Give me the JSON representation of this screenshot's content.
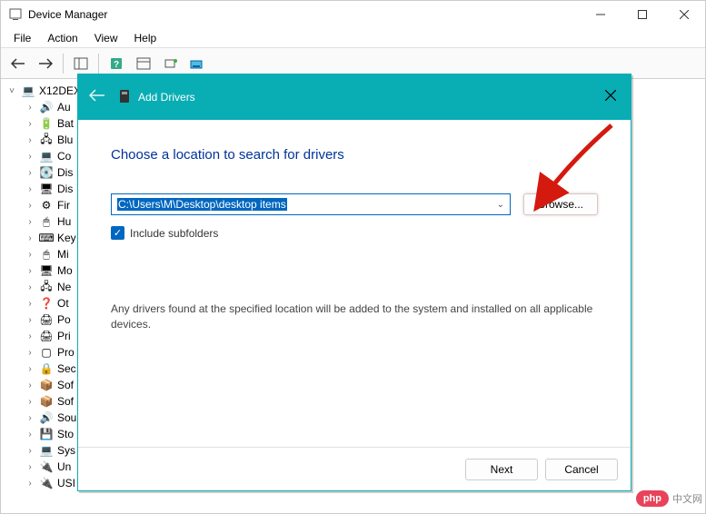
{
  "window": {
    "title": "Device Manager"
  },
  "menubar": {
    "items": [
      "File",
      "Action",
      "View",
      "Help"
    ]
  },
  "tree": {
    "root": "X12DEX",
    "items": [
      {
        "label": "Au",
        "icon": "🔊"
      },
      {
        "label": "Bat",
        "icon": "🔋"
      },
      {
        "label": "Blu",
        "icon": "🖧"
      },
      {
        "label": "Co",
        "icon": "💻"
      },
      {
        "label": "Dis",
        "icon": "💽"
      },
      {
        "label": "Dis",
        "icon": "🖥"
      },
      {
        "label": "Fir",
        "icon": "⚙"
      },
      {
        "label": "Hu",
        "icon": "🖱"
      },
      {
        "label": "Key",
        "icon": "⌨"
      },
      {
        "label": "Mi",
        "icon": "🖱"
      },
      {
        "label": "Mo",
        "icon": "🖥"
      },
      {
        "label": "Ne",
        "icon": "🖧"
      },
      {
        "label": "Ot",
        "icon": "❓"
      },
      {
        "label": "Po",
        "icon": "🖨"
      },
      {
        "label": "Pri",
        "icon": "🖨"
      },
      {
        "label": "Pro",
        "icon": "▢"
      },
      {
        "label": "Sec",
        "icon": "🔒"
      },
      {
        "label": "Sof",
        "icon": "📦"
      },
      {
        "label": "Sof",
        "icon": "📦"
      },
      {
        "label": "Sou",
        "icon": "🔊"
      },
      {
        "label": "Sto",
        "icon": "💾"
      },
      {
        "label": "Sys",
        "icon": "💻"
      },
      {
        "label": "Un",
        "icon": "🔌"
      },
      {
        "label": "USI",
        "icon": "🔌"
      }
    ]
  },
  "dialog": {
    "title": "Add Drivers",
    "heading": "Choose a location to search for drivers",
    "path_value": "C:\\Users\\M\\Desktop\\desktop items",
    "browse_label": "Browse...",
    "include_subfolders_label": "Include subfolders",
    "include_subfolders_checked": true,
    "info_text": "Any drivers found at the specified location will be added to the system and installed on all applicable devices.",
    "next_label": "Next",
    "cancel_label": "Cancel"
  },
  "watermark": {
    "badge": "php",
    "text": "中文网"
  }
}
